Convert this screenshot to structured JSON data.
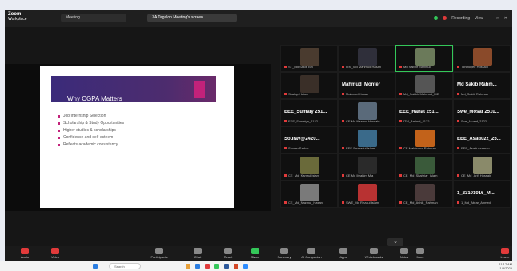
{
  "topbar": {
    "app_name": "Zoom",
    "app_sub": "Workplace",
    "tab1": "Meeting",
    "tab2": "ZA Tagalon Meeting's screen",
    "recording": "Recording",
    "view": "View"
  },
  "slide": {
    "title": "Why CGPA Matters",
    "bullets": [
      "Job/Internship Selection",
      "Scholarship & Study Opportunities",
      "Higher studies & scholarships",
      "Confidence and self-esteem",
      "Reflects academic consistency"
    ]
  },
  "participants": [
    {
      "name": "ST_Md Sakib Bin",
      "type": "photo",
      "color": "#4a3b2f"
    },
    {
      "name": "ITM_Md Mahmud Hasan",
      "type": "photo",
      "color": "#2f2f3a"
    },
    {
      "name": "Md Sabbir Mahmud",
      "type": "photo",
      "color": "#6b7a5a",
      "active": true
    },
    {
      "name": "Tonmoyee Hossain",
      "type": "photo",
      "color": "#8a4a2a"
    },
    {
      "name": "Shafiqul Islam",
      "type": "photo",
      "color": "#3a2f28"
    },
    {
      "name": "Mahmud Hasan",
      "type": "text",
      "big": "Mahmud_Monter"
    },
    {
      "name": "Md_Sabbir Mahmud_ME",
      "type": "photo",
      "color": "#555"
    },
    {
      "name": "Md_Sakib Rahman",
      "type": "text",
      "big": "Md Sakib Rahm..."
    },
    {
      "name": "EEE_Sumaiya_2122",
      "type": "text",
      "big": "EEE_Sumaiy 251..."
    },
    {
      "name": "CE Md Nazmul Hossain",
      "type": "photo",
      "color": "#5a6a7a"
    },
    {
      "name": "ITM_Aminul_2122",
      "type": "text",
      "big": "EEE_Rahat 251..."
    },
    {
      "name": "Swe_Mosaf_2122",
      "type": "text",
      "big": "Swe_Mosaf 2510..."
    },
    {
      "name": "Sourav Sarkar",
      "type": "text",
      "big": "Sourav@2420..."
    },
    {
      "name": "EEE Sazzadul Islam",
      "type": "photo",
      "color": "#3a6a8a"
    },
    {
      "name": "CE Mahbubur Rahman",
      "type": "photo",
      "color": "#c2621a"
    },
    {
      "name": "EEE_Asaduzzaman",
      "type": "text",
      "big": "EEE_Asaduzz_25..."
    },
    {
      "name": "CE_Md_Kamrul Islam",
      "type": "photo",
      "color": "#6a6a3a"
    },
    {
      "name": "CE Md Ibrahim Mia",
      "type": "photo",
      "color": "#2a2a2a"
    },
    {
      "name": "CE_Md_Shahriar_Islam",
      "type": "photo",
      "color": "#3a5a3a"
    },
    {
      "name": "CE_Md_Arif_Hossain",
      "type": "photo",
      "color": "#8a8a6a"
    },
    {
      "name": "CE_Md_Nazmul_Hasan",
      "type": "photo",
      "color": "#7a7a7a"
    },
    {
      "name": "SWE_Md Rezaul Islam",
      "type": "photo",
      "color": "#b83232"
    },
    {
      "name": "CE_Md_Ashik_Rahman",
      "type": "photo",
      "color": "#4a3a3a"
    },
    {
      "name": "1_Md_Abrar_Ahmed",
      "type": "text",
      "big": "1_23101016_M..."
    }
  ],
  "toolbar": {
    "items": [
      "Audio",
      "Video",
      "Participants",
      "Chat",
      "React",
      "Share",
      "Summary",
      "AI Companion",
      "Apps",
      "Whiteboards",
      "Notes",
      "More",
      "Leave"
    ]
  },
  "taskbar": {
    "search": "Search",
    "time": "11:17 AM",
    "date": "1/3/2025"
  }
}
